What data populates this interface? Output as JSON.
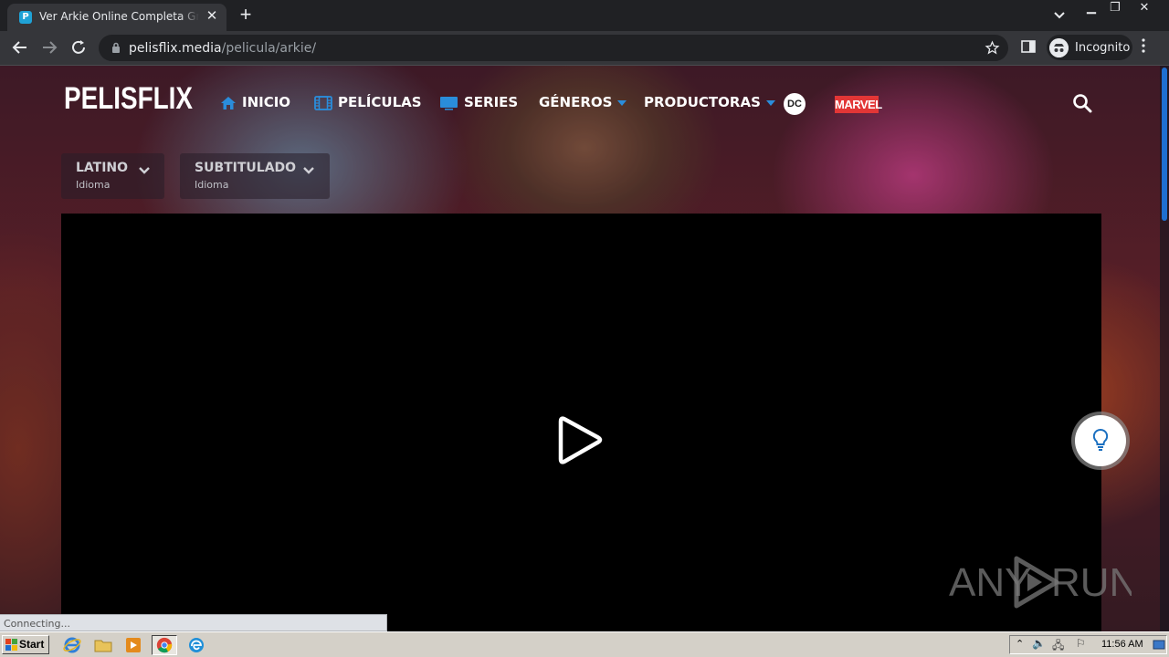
{
  "browser": {
    "tab_title": "Ver Arkie Online Completa Gratis en HD",
    "favicon_letter": "P",
    "url_host": "pelisflix.media",
    "url_path": "/pelicula/arkie/",
    "profile_label": "Incognito"
  },
  "site": {
    "logo": "PELISFLIX",
    "nav": [
      {
        "label": "INICIO",
        "icon": "home-icon"
      },
      {
        "label": "PELÍCULAS",
        "icon": "film-icon"
      },
      {
        "label": "SERIES",
        "icon": "tv-icon"
      },
      {
        "label": "GÉNEROS",
        "dropdown": true
      },
      {
        "label": "PRODUCTORAS",
        "dropdown": true
      }
    ],
    "dc_label": "DC",
    "marvel_label": "MARVEL",
    "accent": "#2a8ddb"
  },
  "languages": [
    {
      "name": "LATINO",
      "sub": "Idioma"
    },
    {
      "name": "SUBTITULADO",
      "sub": "Idioma"
    }
  ],
  "player": {
    "watermark_left": "ANY",
    "watermark_right": "RUN"
  },
  "status_text": "Connecting...",
  "taskbar": {
    "start_label": "Start",
    "clock": "11:56 AM"
  }
}
